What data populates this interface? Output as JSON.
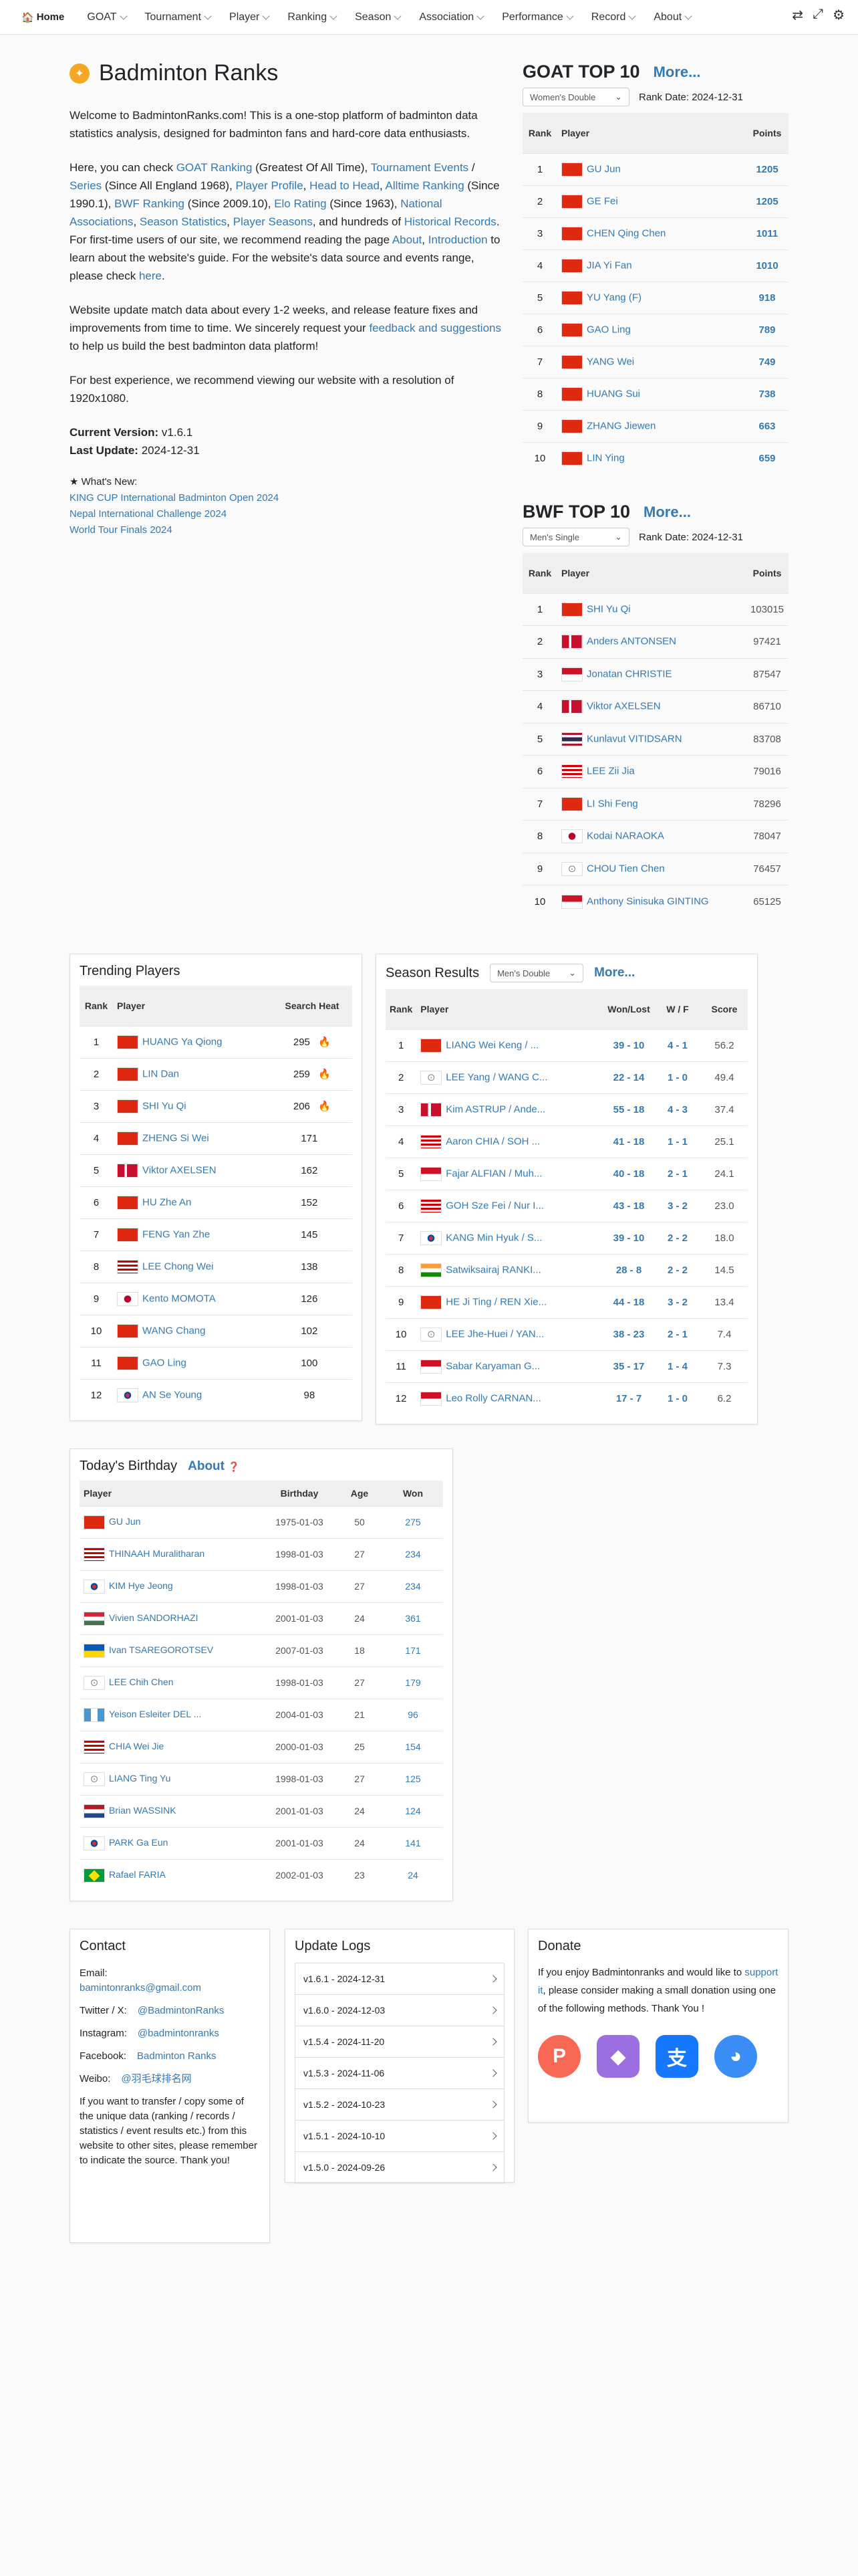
{
  "nav": {
    "home": "Home",
    "items": [
      "GOAT",
      "Tournament",
      "Player",
      "Ranking",
      "Season",
      "Association",
      "Performance",
      "Record",
      "About"
    ]
  },
  "hero": {
    "title": "Badminton Ranks",
    "intro": "Welcome to BadmintonRanks.com! This is a one-stop platform of badminton data statistics analysis, designed for badminton fans and hard-core data enthusiasts.",
    "p2_a": "Here, you can check ",
    "goat": "GOAT Ranking",
    "p2_b": " (Greatest Of All Time), ",
    "events": "Tournament Events",
    "slash": " / ",
    "series": "Series",
    "p2_c": " (Since All England 1968), ",
    "profile": "Player Profile",
    "comma1": ", ",
    "h2h": "Head to Head",
    "comma2": ",",
    "alltime": "Alltime Ranking",
    "p2_d": " (Since 1990.1), ",
    "bwf": "BWF Ranking",
    "p2_e": " (Since 2009.10), ",
    "elo": "Elo Rating",
    "p2_f": " (Since 1963), ",
    "assoc": "National Associations",
    "comma3": ", ",
    "season": "Season Statistics",
    "comma4": ", ",
    "pseason": "Player Seasons",
    "p2_g": ", and hundreds of ",
    "records": "Historical Records",
    "p2_h": ". For first-time users of our site, we recommend reading the page ",
    "about": "About",
    "comma5": ", ",
    "introl": "Introduction",
    "p2_i": " to learn about the website's guide. For the website's data source and events range, please check ",
    "here": "here",
    "dot": ".",
    "p3_a": "Website update match data about every 1-2 weeks, and release feature fixes and improvements from time to time. We sincerely request your ",
    "feedback": "feedback and suggestions",
    "p3_b": " to help us build the best badminton data platform!",
    "p4": "For best experience, we recommend viewing our website with a resolution of 1920x1080.",
    "cv_label": "Current Version:",
    "cv": " v1.6.1",
    "lu_label": "Last Update:",
    "lu": " 2024-12-31",
    "new_label": "★ What's New:",
    "news": [
      "KING CUP International Badminton Open 2024",
      "Nepal International Challenge 2024",
      "World Tour Finals 2024"
    ]
  },
  "goat": {
    "title": "GOAT TOP 10",
    "more": "More...",
    "select": "Women's Double",
    "date": "Rank Date: 2024-12-31",
    "h": [
      "Rank",
      "Player",
      "Points"
    ],
    "rows": [
      [
        "1",
        "chn",
        "GU Jun",
        "1205"
      ],
      [
        "2",
        "chn",
        "GE Fei",
        "1205"
      ],
      [
        "3",
        "chn",
        "CHEN Qing Chen",
        "1011"
      ],
      [
        "4",
        "chn",
        "JIA Yi Fan",
        "1010"
      ],
      [
        "5",
        "chn",
        "YU Yang (F)",
        "918"
      ],
      [
        "6",
        "chn",
        "GAO Ling",
        "789"
      ],
      [
        "7",
        "chn",
        "YANG Wei",
        "749"
      ],
      [
        "8",
        "chn",
        "HUANG Sui",
        "738"
      ],
      [
        "9",
        "chn",
        "ZHANG Jiewen",
        "663"
      ],
      [
        "10",
        "chn",
        "LIN Ying",
        "659"
      ]
    ]
  },
  "bwf": {
    "title": "BWF TOP 10",
    "more": "More...",
    "select": "Men's Single",
    "date": "Rank Date: 2024-12-31",
    "h": [
      "Rank",
      "Player",
      "Points"
    ],
    "rows": [
      [
        "1",
        "chn",
        "SHI Yu Qi",
        "103015"
      ],
      [
        "2",
        "den",
        "Anders ANTONSEN",
        "97421"
      ],
      [
        "3",
        "ina",
        "Jonatan CHRISTIE",
        "87547"
      ],
      [
        "4",
        "den",
        "Viktor AXELSEN",
        "86710"
      ],
      [
        "5",
        "tha",
        "Kunlavut VITIDSARN",
        "83708"
      ],
      [
        "6",
        "mas",
        "LEE Zii Jia",
        "79016"
      ],
      [
        "7",
        "chn",
        "LI Shi Feng",
        "78296"
      ],
      [
        "8",
        "jpn",
        "Kodai NARAOKA",
        "78047"
      ],
      [
        "9",
        "tpe",
        "CHOU Tien Chen",
        "76457"
      ],
      [
        "10",
        "ina",
        "Anthony Sinisuka GINTING",
        "65125"
      ]
    ]
  },
  "trend": {
    "title": "Trending Players",
    "h": [
      "Rank",
      "Player",
      "Search Heat"
    ],
    "rows": [
      [
        "1",
        "chn",
        "HUANG Ya Qiong",
        "295",
        "🔥"
      ],
      [
        "2",
        "chn",
        "LIN Dan",
        "259",
        "🔥"
      ],
      [
        "3",
        "chn",
        "SHI Yu Qi",
        "206",
        "🔥"
      ],
      [
        "4",
        "chn",
        "ZHENG Si Wei",
        "171",
        ""
      ],
      [
        "5",
        "den",
        "Viktor AXELSEN",
        "162",
        ""
      ],
      [
        "6",
        "chn",
        "HU Zhe An",
        "152",
        ""
      ],
      [
        "7",
        "chn",
        "FENG Yan Zhe",
        "145",
        ""
      ],
      [
        "8",
        "mas",
        "LEE Chong Wei",
        "138",
        ""
      ],
      [
        "9",
        "jpn",
        "Kento MOMOTA",
        "126",
        ""
      ],
      [
        "10",
        "chn",
        "WANG Chang",
        "102",
        ""
      ],
      [
        "11",
        "chn",
        "GAO Ling",
        "100",
        ""
      ],
      [
        "12",
        "kor",
        "AN Se Young",
        "98",
        ""
      ]
    ]
  },
  "season": {
    "title": "Season Results",
    "select": "Men's Double",
    "more": "More...",
    "h": [
      "Rank",
      "Player",
      "Won/Lost",
      "W / F",
      "Score"
    ],
    "rows": [
      [
        "1",
        "chn",
        "LIANG Wei Keng / ...",
        "39 - 10",
        "4 - 1",
        "56.2"
      ],
      [
        "2",
        "tpe",
        "LEE Yang / WANG C...",
        "22 - 14",
        "1 - 0",
        "49.4"
      ],
      [
        "3",
        "den",
        "Kim ASTRUP / Ande...",
        "55 - 18",
        "4 - 3",
        "37.4"
      ],
      [
        "4",
        "mas",
        "Aaron CHIA / SOH ...",
        "41 - 18",
        "1 - 1",
        "25.1"
      ],
      [
        "5",
        "ina",
        "Fajar ALFIAN / Muh...",
        "40 - 18",
        "2 - 1",
        "24.1"
      ],
      [
        "6",
        "mas",
        "GOH Sze Fei / Nur I...",
        "43 - 18",
        "3 - 2",
        "23.0"
      ],
      [
        "7",
        "kor",
        "KANG Min Hyuk / S...",
        "39 - 10",
        "2 - 2",
        "18.0"
      ],
      [
        "8",
        "ind",
        "Satwiksairaj RANKI...",
        "28 - 8",
        "2 - 2",
        "14.5"
      ],
      [
        "9",
        "chn",
        "HE Ji Ting / REN Xie...",
        "44 - 18",
        "3 - 2",
        "13.4"
      ],
      [
        "10",
        "tpe",
        "LEE Jhe-Huei / YAN...",
        "38 - 23",
        "2 - 1",
        "7.4"
      ],
      [
        "11",
        "ina",
        "Sabar Karyaman G...",
        "35 - 17",
        "1 - 4",
        "7.3"
      ],
      [
        "12",
        "ina",
        "Leo Rolly CARNAN...",
        "17 - 7",
        "1 - 0",
        "6.2"
      ]
    ]
  },
  "bday": {
    "title": "Today's Birthday",
    "about": "About",
    "h": [
      "Player",
      "Birthday",
      "Age",
      "Won"
    ],
    "rows": [
      [
        "chn",
        "GU Jun",
        "1975-01-03",
        "50",
        "275"
      ],
      [
        "mas",
        "THINAAH Muralitharan",
        "1998-01-03",
        "27",
        "234"
      ],
      [
        "kor",
        "KIM Hye Jeong",
        "1998-01-03",
        "27",
        "234"
      ],
      [
        "hun",
        "Vivien SANDORHAZI",
        "2001-01-03",
        "24",
        "361"
      ],
      [
        "ukr",
        "Ivan TSAREGOROTSEV",
        "2007-01-03",
        "18",
        "171"
      ],
      [
        "tpe",
        "LEE Chih Chen",
        "1998-01-03",
        "27",
        "179"
      ],
      [
        "gua",
        "Yeison Esleiter DEL ...",
        "2004-01-03",
        "21",
        "96"
      ],
      [
        "mas",
        "CHIA Wei Jie",
        "2000-01-03",
        "25",
        "154"
      ],
      [
        "tpe",
        "LIANG Ting Yu",
        "1998-01-03",
        "27",
        "125"
      ],
      [
        "ned",
        "Brian WASSINK",
        "2001-01-03",
        "24",
        "124"
      ],
      [
        "kor",
        "PARK Ga Eun",
        "2001-01-03",
        "24",
        "141"
      ],
      [
        "bra",
        "Rafael FARIA",
        "2002-01-03",
        "23",
        "24"
      ]
    ]
  },
  "contact": {
    "title": "Contact",
    "email_label": "Email:",
    "email": "bamintonranks@gmail.com",
    "tw_label": "Twitter / X:",
    "tw": "@BadmintonRanks",
    "ig_label": "Instagram:",
    "ig": "@badmintonranks",
    "fb_label": "Facebook:",
    "fb": "Badminton Ranks",
    "wb_label": "Weibo:",
    "wb": "@羽毛球排名网",
    "note": "If you want to transfer / copy some of the unique data (ranking / records / statistics / event results etc.) from this website to other sites, please remember to indicate the source. Thank you!"
  },
  "logs": {
    "title": "Update Logs",
    "items": [
      "v1.6.1 - 2024-12-31",
      "v1.6.0 - 2024-12-03",
      "v1.5.4 - 2024-11-20",
      "v1.5.3 - 2024-11-06",
      "v1.5.2 - 2024-10-23",
      "v1.5.1 - 2024-10-10",
      "v1.5.0 - 2024-09-26"
    ]
  },
  "donate": {
    "title": "Donate",
    "a": "If you enjoy Badmintonranks and would like to ",
    "support": "support it",
    "b": ", please consider making a small donation using one of the following methods. Thank You !"
  }
}
